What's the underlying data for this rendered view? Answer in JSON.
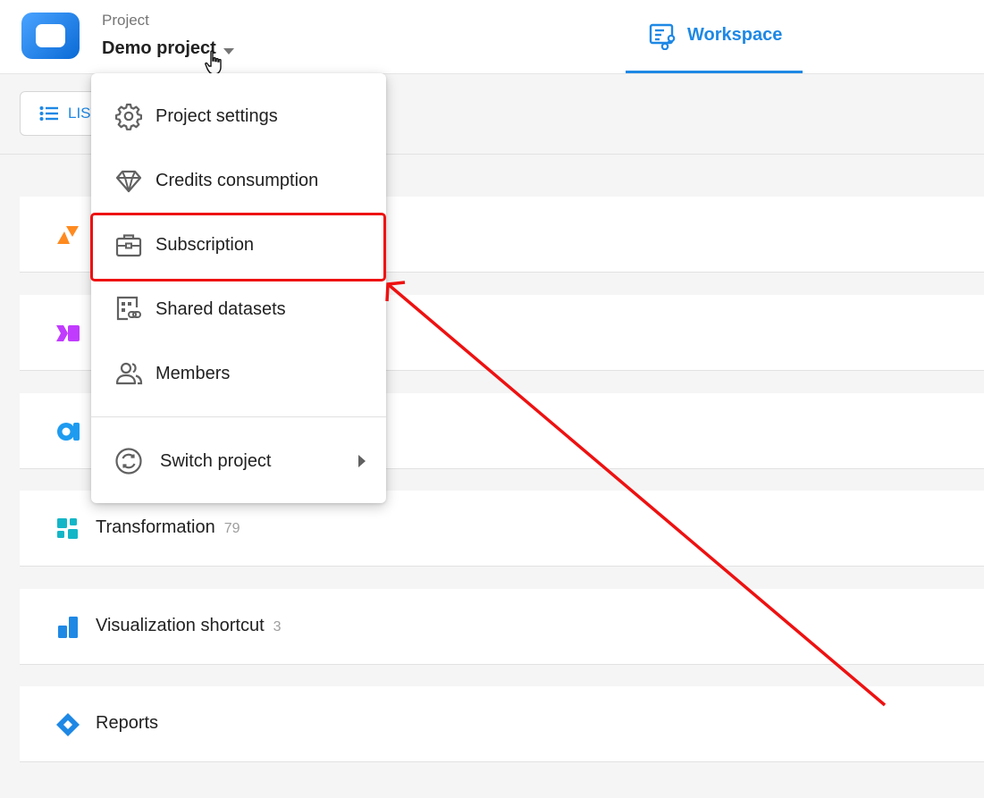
{
  "header": {
    "project_label": "Project",
    "project_name": "Demo project",
    "tab_label": "Workspace"
  },
  "toolbar": {
    "list_label": "LIST"
  },
  "menu": {
    "items": [
      {
        "label": "Project settings",
        "icon": "gear-icon"
      },
      {
        "label": "Credits consumption",
        "icon": "diamond-icon"
      },
      {
        "label": "Subscription",
        "icon": "briefcase-icon"
      },
      {
        "label": "Shared datasets",
        "icon": "shared-dataset-icon"
      },
      {
        "label": "Members",
        "icon": "members-icon"
      }
    ],
    "switch_label": "Switch project"
  },
  "rows": [
    {
      "label": "",
      "icon": "orange-triangles-icon",
      "color": "#ff8a1f"
    },
    {
      "label": "",
      "icon": "purple-arrow-icon",
      "color": "#c13bff"
    },
    {
      "label": "",
      "icon": "blue-circle-icon",
      "color": "#1e9bf0"
    },
    {
      "label": "Transformation",
      "count": "79",
      "icon": "transformation-icon",
      "color": "#13b6c7"
    },
    {
      "label": "Visualization shortcut",
      "count": "3",
      "icon": "bar-chart-icon",
      "color": "#1e88e5"
    },
    {
      "label": "Reports",
      "icon": "reports-diamond-icon",
      "color": "#1e88e5"
    }
  ],
  "colors": {
    "accent": "#1e88e5",
    "annotation": "#ee1111"
  }
}
